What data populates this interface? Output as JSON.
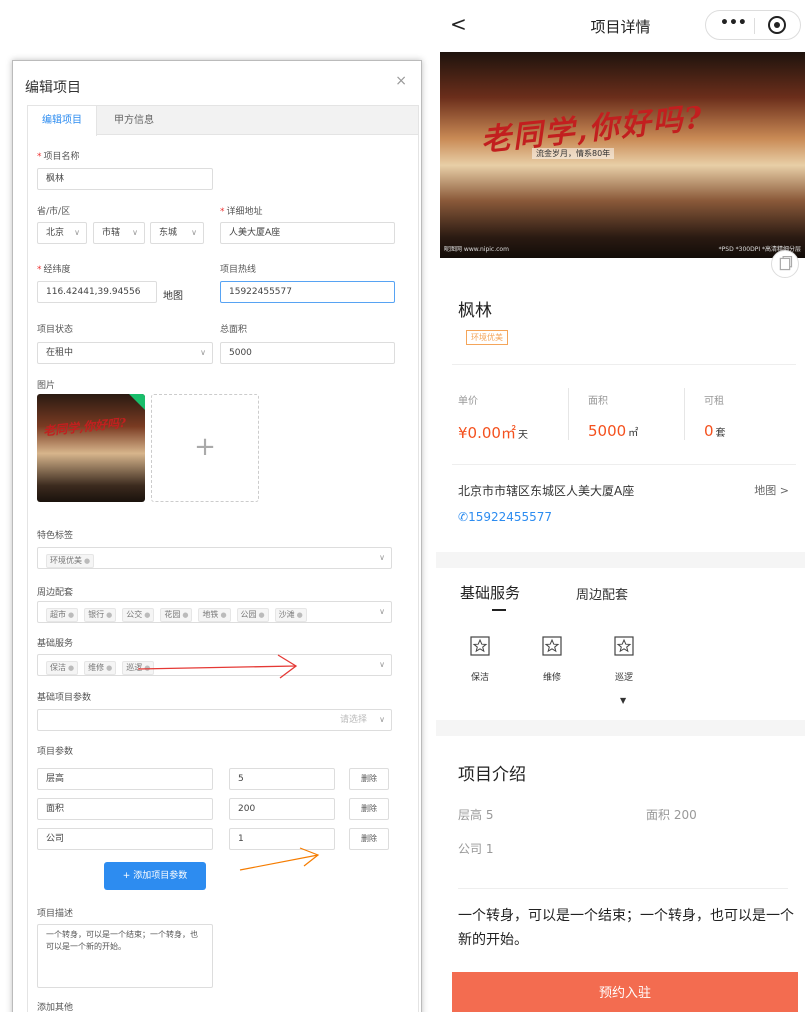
{
  "editor": {
    "title": "编辑项目",
    "close": "×",
    "tabs": [
      "编辑项目",
      "甲方信息"
    ],
    "name_label": "项目名称",
    "name_value": "枫林",
    "region_label": "省/市/区",
    "province": "北京",
    "city": "市辖",
    "district": "东城",
    "address_label": "详细地址",
    "address_value": "人美大厦A座",
    "coords_label": "经纬度",
    "coords_value": "116.42441,39.94556",
    "map_text": "地图",
    "hotline_label": "项目热线",
    "hotline_value": "15922455577",
    "status_label": "项目状态",
    "status_value": "在租中",
    "area_label": "总面积",
    "area_value": "5000",
    "image_label": "图片",
    "features_label": "特色标签",
    "features": [
      "环境优美"
    ],
    "nearby_label": "周边配套",
    "nearby": [
      "超市",
      "银行",
      "公交",
      "花园",
      "地铁",
      "公园",
      "沙滩"
    ],
    "services_label": "基础服务",
    "services": [
      "保洁",
      "维修",
      "巡逻"
    ],
    "base_params_label": "基础项目参数",
    "base_params_placeholder": "请选择",
    "params_label": "项目参数",
    "params": [
      {
        "key": "层高",
        "value": "5",
        "del": "删除"
      },
      {
        "key": "面积",
        "value": "200",
        "del": "删除"
      },
      {
        "key": "公司",
        "value": "1",
        "del": "删除"
      }
    ],
    "add_param_label": "+ 添加项目参数",
    "desc_label": "项目描述",
    "desc_value": "一个转身，可以是一个结束；一个转身，也可以是一个新的开始。",
    "other_label": "添加其他"
  },
  "detail": {
    "nav_title": "项目详情",
    "back_icon": "chevron-left-icon",
    "more_label": "•••",
    "banner_title": "老同学,你好吗?",
    "banner_sub": "流金岁月，情系80年",
    "banner_foot_left": "昵图网 www.nipic.com",
    "banner_foot_right": "*PSD *300DPI *高清精细分层",
    "name": "枫林",
    "tag": "环境优美",
    "price_label": "单价",
    "price_value": "¥0.00㎡",
    "price_unit": "天",
    "area_label": "面积",
    "area_value": "5000",
    "area_unit": "㎡",
    "rent_label": "可租",
    "rent_value": "0",
    "rent_unit": "套",
    "address": "北京市市辖区东城区人美大厦A座",
    "map_link": "地图 >",
    "phone": "15922455577",
    "tabs": [
      "基础服务",
      "周边配套"
    ],
    "services": [
      "保洁",
      "维修",
      "巡逻"
    ],
    "expand_icon": "▼",
    "intro_title": "项目介绍",
    "params": [
      {
        "text": "层高  5"
      },
      {
        "text": "面积  200"
      },
      {
        "text": "公司  1"
      }
    ],
    "description": "一个转身，可以是一个结束；一个转身，也可以是一个新的开始。",
    "book_label": "预约入驻"
  },
  "colors": {
    "primary_blue": "#2d8cf0",
    "price_red": "#f4511e",
    "button_orange": "#f36c50",
    "annotation_red": "#e53935",
    "annotation_orange": "#f57c00"
  }
}
